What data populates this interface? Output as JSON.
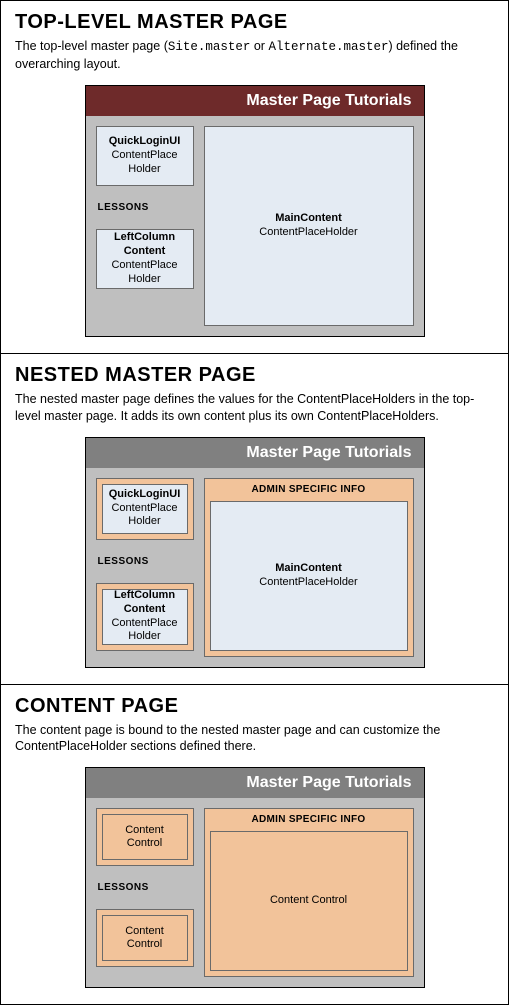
{
  "sections": {
    "top": {
      "title": "TOP-LEVEL MASTER PAGE",
      "desc_pre": "The top-level master page (",
      "code1": "Site.master",
      "desc_mid": " or ",
      "code2": "Alternate.master",
      "desc_post": ") defined the overarching layout.",
      "header": "Master Page Tutorials",
      "quicklogin_b": "QuickLoginUI",
      "quicklogin_t": "ContentPlace Holder",
      "lessons": "LESSONS",
      "leftcol_b": "LeftColumn Content",
      "leftcol_t": "ContentPlace Holder",
      "main_b": "MainContent",
      "main_t": "ContentPlaceHolder"
    },
    "nested": {
      "title": "NESTED MASTER PAGE",
      "desc": "The nested master page defines the values for the ContentPlaceHolders in the top-level master page. It adds its own content plus its own ContentPlaceHolders.",
      "header": "Master Page Tutorials",
      "quicklogin_b": "QuickLoginUI",
      "quicklogin_t": "ContentPlace Holder",
      "lessons": "LESSONS",
      "leftcol_b": "LeftColumn Content",
      "leftcol_t": "ContentPlace Holder",
      "admin": "ADMIN SPECIFIC INFO",
      "main_b": "MainContent",
      "main_t": "ContentPlaceHolder"
    },
    "content": {
      "title": "CONTENT PAGE",
      "desc": "The content page is bound to the nested master page and can customize the ContentPlaceHolder sections defined there.",
      "header": "Master Page Tutorials",
      "cc1": "Content Control",
      "lessons": "LESSONS",
      "cc2": "Content Control",
      "admin": "ADMIN SPECIFIC INFO",
      "cc3": "Content Control"
    }
  }
}
